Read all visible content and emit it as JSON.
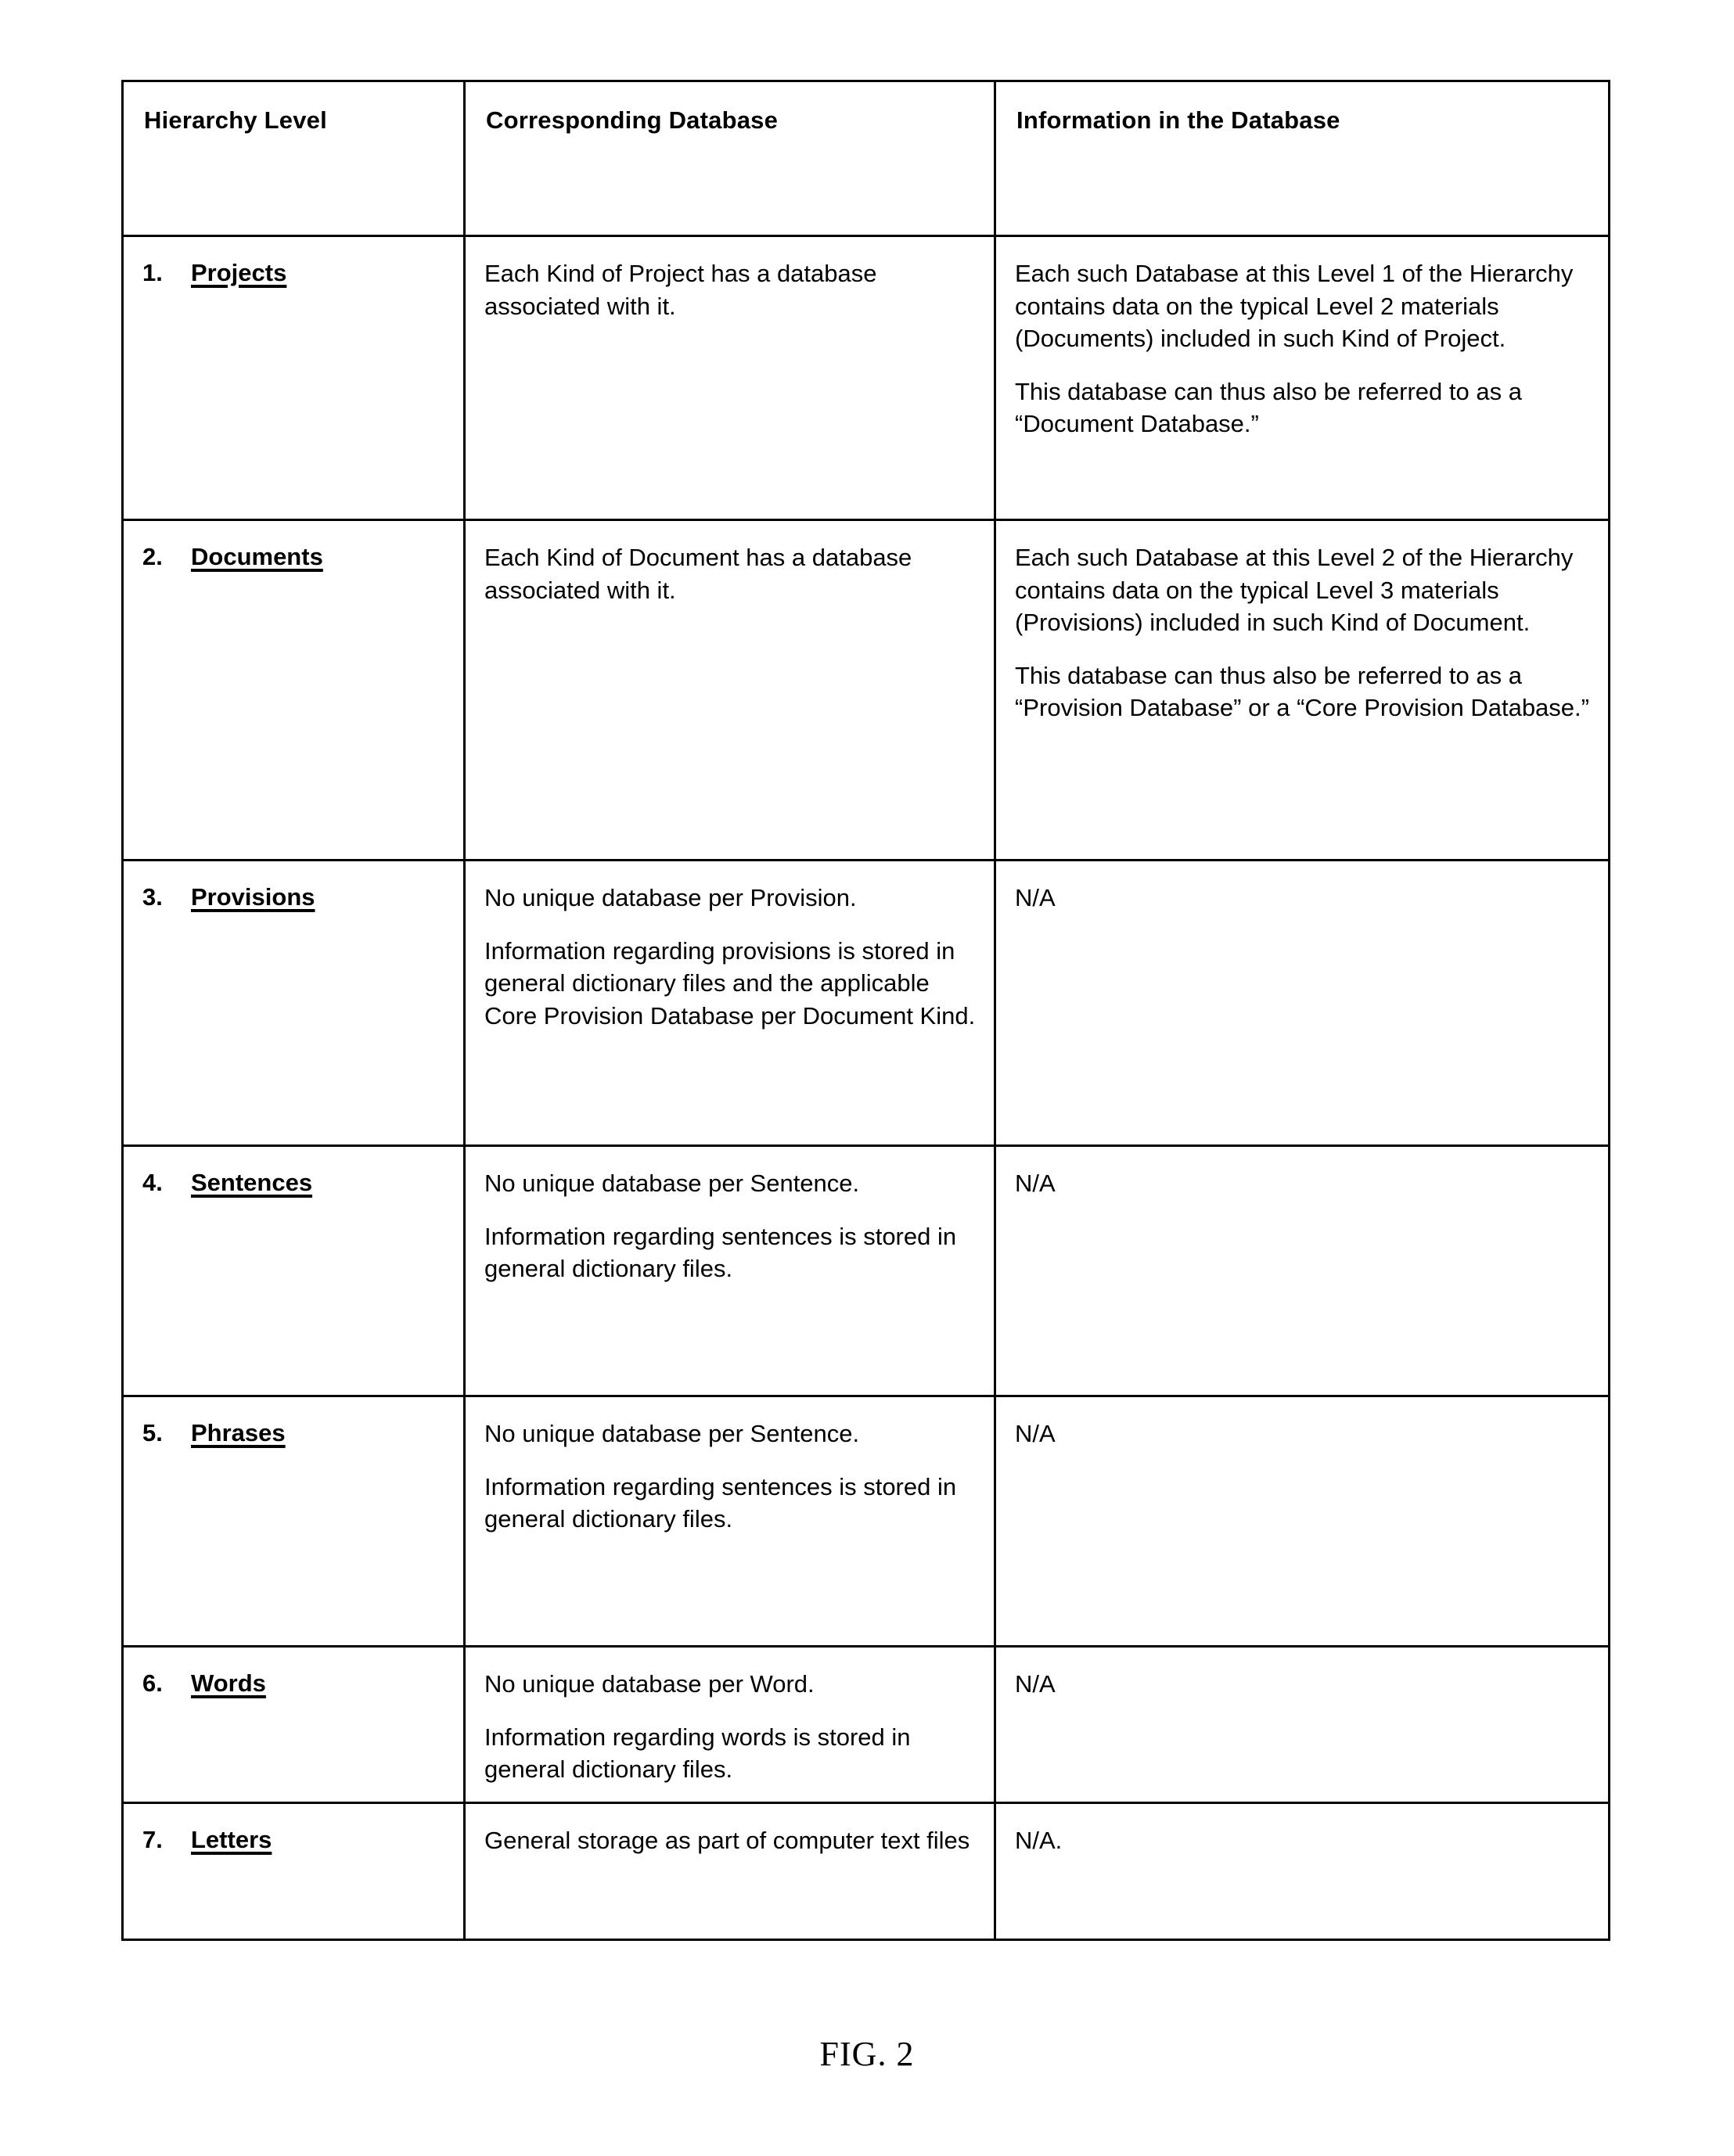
{
  "figure": {
    "caption": "FIG. 2"
  },
  "table": {
    "columns": [
      "Hierarchy Level",
      "Corresponding Database",
      "Information in the Database"
    ],
    "rows": [
      {
        "number": "1.",
        "level": "Projects",
        "database": [
          "Each Kind of Project has a database associated with it."
        ],
        "information": [
          "Each such Database at this Level 1 of the Hierarchy contains data on the typical Level 2 materials (Documents) included in such Kind of Project.",
          "This database can thus also be referred to as a “Document Database.”"
        ]
      },
      {
        "number": "2.",
        "level": "Documents",
        "database": [
          "Each Kind of Document has a database associated with it."
        ],
        "information": [
          "Each such Database at this Level 2 of the Hierarchy contains data on the typical Level 3 materials (Provisions) included in such Kind of Document.",
          "This database can thus also be referred to as a “Provision Database” or a “Core Provision Database.”"
        ]
      },
      {
        "number": "3.",
        "level": "Provisions",
        "database": [
          "No unique database per Provision.",
          "Information regarding provisions is stored in general dictionary files and the applicable Core Provision Database per Document Kind."
        ],
        "information": [
          "N/A"
        ]
      },
      {
        "number": "4.",
        "level": "Sentences",
        "database": [
          "No unique database per Sentence.",
          "Information regarding sentences is stored in general dictionary files."
        ],
        "information": [
          "N/A"
        ]
      },
      {
        "number": "5.",
        "level": "Phrases",
        "database": [
          "No unique database per Sentence.",
          "Information regarding sentences is stored in general dictionary files."
        ],
        "information": [
          "N/A"
        ]
      },
      {
        "number": "6.",
        "level": "Words",
        "database": [
          "No unique database per Word.",
          "Information regarding words is stored in general dictionary files."
        ],
        "information": [
          "N/A"
        ]
      },
      {
        "number": "7.",
        "level": "Letters",
        "database": [
          "General storage as part of computer text files"
        ],
        "information": [
          "N/A."
        ]
      }
    ]
  }
}
